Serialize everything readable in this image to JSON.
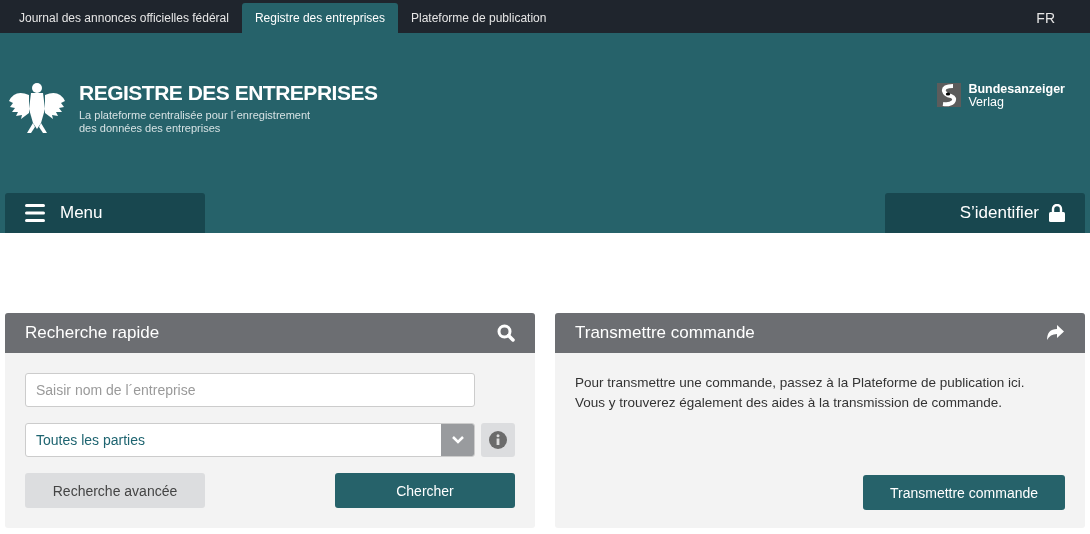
{
  "top_tabs": [
    {
      "label": "Journal des annonces officielles fédéral",
      "selected": false
    },
    {
      "label": "Registre des entreprises",
      "selected": true
    },
    {
      "label": "Plateforme de publication",
      "selected": false
    }
  ],
  "language": "FR",
  "header": {
    "title": "REGISTRE DES ENTREPRISES",
    "subtitle_lines": [
      "La plateforme centralisée pour l´enregistrement",
      "des données des entreprises"
    ],
    "publisher": {
      "name": "Bundesanzeiger",
      "suffix": "Verlag"
    }
  },
  "menu_button": "Menu",
  "login_button": "S’identifier",
  "quick_search": {
    "title": "Recherche rapide",
    "name_field": {
      "placeholder": "Saisir nom de l´entreprise"
    },
    "scope_select": {
      "value": "Toutes les parties"
    },
    "advanced_button": "Recherche avancée",
    "search_button": "Chercher"
  },
  "submit_order": {
    "title": "Transmettre commande",
    "text": "Pour transmettre une commande, passez à la Plateforme de publication ici. Vous y trouverez également des aides à la transmission de commande.",
    "button": "Transmettre commande"
  }
}
